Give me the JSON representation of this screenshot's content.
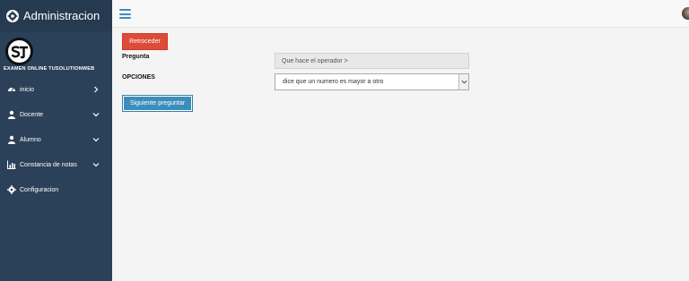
{
  "app": {
    "title": "Administracion"
  },
  "logo": {
    "text": "EXAMEN ONLINE TUSOLUTIONWEB",
    "mark": "ST"
  },
  "sidebar": {
    "items": [
      {
        "label": "inicio",
        "icon": "dashboard-icon",
        "chevron": "chevron-right-icon"
      },
      {
        "label": "Docente",
        "icon": "teacher-icon",
        "chevron": "chevron-down-icon"
      },
      {
        "label": "Alumno",
        "icon": "student-icon",
        "chevron": "chevron-down-icon"
      },
      {
        "label": "Constancia de notas",
        "icon": "bar-chart-icon",
        "chevron": "chevron-down-icon"
      },
      {
        "label": "Configuracion",
        "icon": "gear-icon",
        "chevron": ""
      }
    ]
  },
  "form": {
    "back_label": "Retroceder",
    "question_label": "Pregunta",
    "question_value": "Que hace el operador >",
    "options_label": "OPCIONES",
    "selected_option": "dice que un numero es mayor a otro",
    "next_label": "Siguiente preguntar"
  },
  "colors": {
    "sidebar": "#2b4159",
    "accent": "#3c8dbc",
    "danger": "#dd4b39"
  }
}
